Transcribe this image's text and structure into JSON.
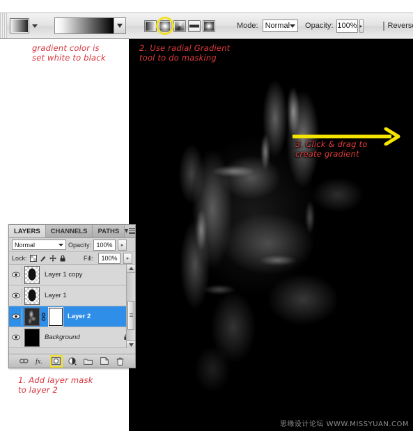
{
  "options_bar": {
    "tool_icon": "gradient-tool-icon",
    "preset_label": "white-to-black-gradient",
    "gradient_types": [
      {
        "name": "linear-gradient",
        "label": "Linear Gradient",
        "selected": false
      },
      {
        "name": "radial-gradient",
        "label": "Radial Gradient",
        "selected": true
      },
      {
        "name": "angle-gradient",
        "label": "Angle Gradient",
        "selected": false
      },
      {
        "name": "reflected-gradient",
        "label": "Reflected Gradient",
        "selected": false
      },
      {
        "name": "diamond-gradient",
        "label": "Diamond Gradient",
        "selected": false
      }
    ],
    "mode_label": "Mode:",
    "mode_value": "Normal",
    "opacity_label": "Opacity:",
    "opacity_value": "100%",
    "reverse_label": "Reverse",
    "spinner_glyph": "▸"
  },
  "annotations": [
    {
      "id": "gradient-color",
      "text": "gradient color is\nset white to black"
    },
    {
      "id": "radial-tool",
      "text": "2. Use radial Gradient\ntool to do masking"
    },
    {
      "id": "click-drag",
      "text": "3. Click & drag to\ncreate gradient"
    },
    {
      "id": "add-mask",
      "text": "1. Add layer mask\nto layer 2"
    }
  ],
  "arrow": {
    "name": "yellow-drag-arrow",
    "color": "#f5e400"
  },
  "layers_panel": {
    "tabs": [
      {
        "label": "LAYERS",
        "active": true
      },
      {
        "label": "CHANNELS",
        "active": false
      },
      {
        "label": "PATHS",
        "active": false
      }
    ],
    "blend_mode": "Normal",
    "opacity_label": "Opacity:",
    "opacity_value": "100%",
    "lock_label": "Lock:",
    "lock_icons": [
      "lock-transparency-icon",
      "lock-image-icon",
      "lock-position-icon",
      "lock-all-icon"
    ],
    "fill_label": "Fill:",
    "fill_value": "100%",
    "spinner_glyph": "▸",
    "layers": [
      {
        "name": "Layer 1 copy",
        "selected": false,
        "has_mask": false,
        "locked": false,
        "thumb": "blob"
      },
      {
        "name": "Layer 1",
        "selected": false,
        "has_mask": false,
        "locked": false,
        "thumb": "blob"
      },
      {
        "name": "Layer 2",
        "selected": true,
        "has_mask": true,
        "locked": false,
        "thumb": "smoke"
      },
      {
        "name": "Background",
        "selected": false,
        "has_mask": false,
        "locked": true,
        "thumb": "black"
      }
    ],
    "bottom_buttons": [
      {
        "name": "link-layers-button",
        "glyph": "∞",
        "highlight": false
      },
      {
        "name": "layer-style-fx-button",
        "glyph": "fx.",
        "highlight": false
      },
      {
        "name": "add-layer-mask-button",
        "glyph": "▣",
        "highlight": true
      },
      {
        "name": "new-adjustment-layer-button",
        "glyph": "◑",
        "highlight": false
      },
      {
        "name": "new-group-button",
        "glyph": "▭",
        "highlight": false
      },
      {
        "name": "new-layer-button",
        "glyph": "❐",
        "highlight": false
      },
      {
        "name": "delete-layer-button",
        "glyph": "⌦",
        "highlight": false
      }
    ]
  },
  "watermark": {
    "text": "思缘设计论坛  WWW.MISSYUAN.COM"
  }
}
